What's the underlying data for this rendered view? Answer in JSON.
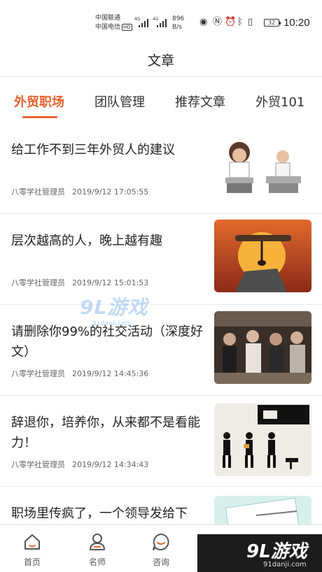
{
  "status_bar": {
    "carrier_1": "中国联通",
    "carrier_2": "中国电信",
    "hd": "HD",
    "signal_tag_1": "4G",
    "signal_tag_2": "4G",
    "speed_value": "896",
    "speed_unit": "B/s",
    "battery": "32",
    "time": "10:20"
  },
  "header": {
    "title": "文章"
  },
  "tabs": [
    {
      "label": "外贸职场",
      "active": true
    },
    {
      "label": "团队管理",
      "active": false
    },
    {
      "label": "推荐文章",
      "active": false
    },
    {
      "label": "外贸101",
      "active": false
    }
  ],
  "articles": [
    {
      "title": "给工作不到三年外贸人的建议",
      "author": "八零学社管理员",
      "time": "2019/9/12 17:05:55"
    },
    {
      "title": "层次越高的人，晚上越有趣",
      "author": "八零学社管理员",
      "time": "2019/9/12 15:01:53"
    },
    {
      "title": "请删除你99%的社交活动（深度好文）",
      "author": "八零学社管理员",
      "time": "2019/9/12 14:45:36"
    },
    {
      "title": "辞退你，培养你，从来都不是看能力！",
      "author": "八零学社管理员",
      "time": "2019/9/12 14:34:43"
    },
    {
      "title": "职场里传疯了，一个领导发给下",
      "author": "",
      "time": ""
    }
  ],
  "watermark": {
    "logo": "9L游戏",
    "url": "91danji.com"
  },
  "bottom_nav": [
    {
      "label": "首页",
      "icon": "home-icon"
    },
    {
      "label": "名师",
      "icon": "teacher-icon"
    },
    {
      "label": "咨询",
      "icon": "chat-bubble-icon"
    }
  ],
  "corner_logo": {
    "brand": "9L游戏",
    "url": "91danji.com"
  },
  "colors": {
    "accent": "#e8612c",
    "divider": "#ececec"
  }
}
